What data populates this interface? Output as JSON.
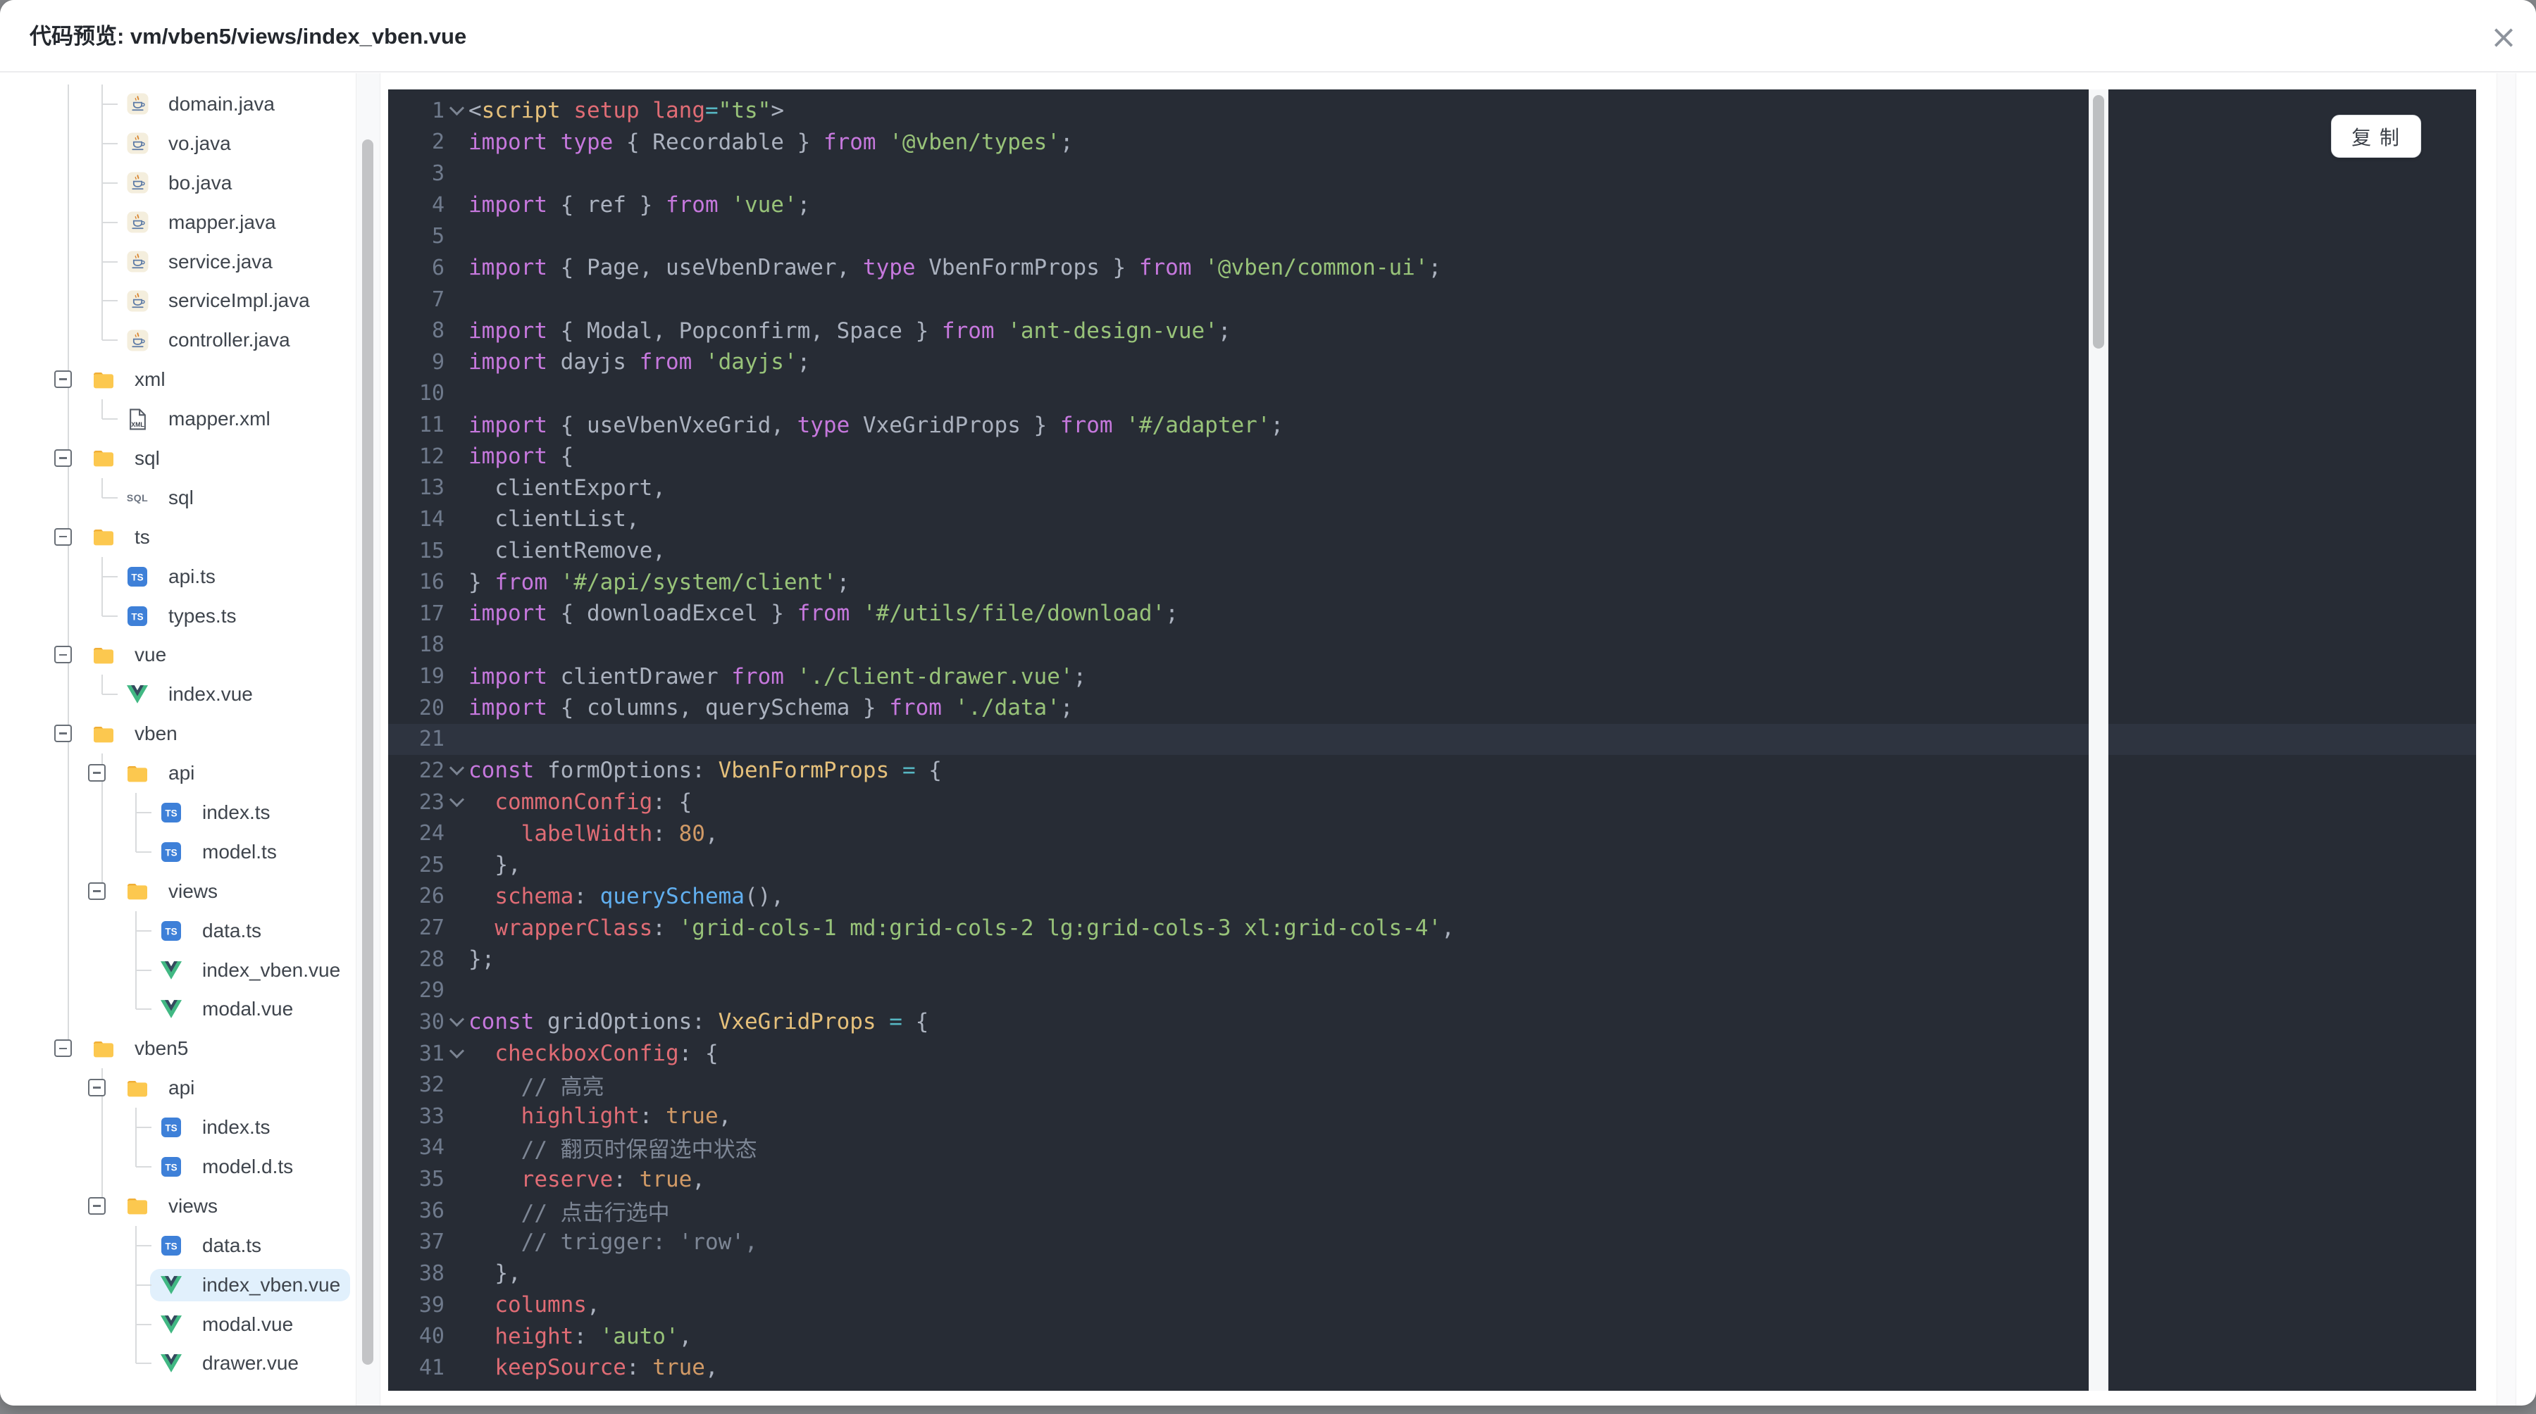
{
  "window": {
    "title": "代码预览: vm/vben5/views/index_vben.vue",
    "close_icon": "×"
  },
  "colors": {
    "code_bg": "#272c35",
    "code_active_line": "#2e3440",
    "gutter_number": "#6f7a8c",
    "token_plain": "#abb2bf",
    "token_keyword": "#c678dd",
    "token_string": "#98c379",
    "token_type": "#e5c07b",
    "token_property": "#e06c75",
    "token_number": "#d19a66",
    "token_function": "#61afef",
    "token_comment": "#7d8695",
    "token_operator": "#56b6c2",
    "selected_row_bg": "#e1f0fc",
    "folder_icon": "#fcc84f",
    "ts_badge": "#3e80d8",
    "vue_green": "#41b883",
    "vue_dark": "#35495e"
  },
  "tree": {
    "rows": [
      {
        "l": 1,
        "label": "domain.java",
        "icon": "java",
        "e": "cont",
        "g": [
          0
        ]
      },
      {
        "l": 1,
        "label": "vo.java",
        "icon": "java",
        "e": "cont",
        "g": [
          0
        ]
      },
      {
        "l": 1,
        "label": "bo.java",
        "icon": "java",
        "e": "cont",
        "g": [
          0
        ]
      },
      {
        "l": 1,
        "label": "mapper.java",
        "icon": "java",
        "e": "cont",
        "g": [
          0
        ]
      },
      {
        "l": 1,
        "label": "service.java",
        "icon": "java",
        "e": "cont",
        "g": [
          0
        ]
      },
      {
        "l": 1,
        "label": "serviceImpl.java",
        "icon": "java",
        "e": "cont",
        "g": [
          0
        ]
      },
      {
        "l": 1,
        "label": "controller.java",
        "icon": "java",
        "e": "last",
        "g": [
          0
        ]
      },
      {
        "l": 0,
        "label": "xml",
        "icon": "folder",
        "t": 1,
        "g": [
          0
        ]
      },
      {
        "l": 1,
        "label": "mapper.xml",
        "icon": "xml",
        "e": "last",
        "g": [
          0
        ]
      },
      {
        "l": 0,
        "label": "sql",
        "icon": "folder",
        "t": 1,
        "g": [
          0
        ]
      },
      {
        "l": 1,
        "label": "sql",
        "icon": "sql",
        "e": "last",
        "g": [
          0
        ]
      },
      {
        "l": 0,
        "label": "ts",
        "icon": "folder",
        "t": 1,
        "g": [
          0
        ]
      },
      {
        "l": 1,
        "label": "api.ts",
        "icon": "ts",
        "e": "cont",
        "g": [
          0
        ]
      },
      {
        "l": 1,
        "label": "types.ts",
        "icon": "ts",
        "e": "last",
        "g": [
          0
        ]
      },
      {
        "l": 0,
        "label": "vue",
        "icon": "folder",
        "t": 1,
        "g": [
          0
        ]
      },
      {
        "l": 1,
        "label": "index.vue",
        "icon": "vue",
        "e": "last",
        "g": [
          0
        ]
      },
      {
        "l": 0,
        "label": "vben",
        "icon": "folder",
        "t": 1,
        "g": [
          0
        ]
      },
      {
        "l": 1,
        "label": "api",
        "icon": "folder",
        "t": 1,
        "g": [
          0,
          1
        ]
      },
      {
        "l": 2,
        "label": "index.ts",
        "icon": "ts",
        "e": "cont",
        "g": [
          0,
          1
        ]
      },
      {
        "l": 2,
        "label": "model.ts",
        "icon": "ts",
        "e": "last",
        "g": [
          0,
          1
        ]
      },
      {
        "l": 1,
        "label": "views",
        "icon": "folder",
        "t": 1,
        "g": [
          0
        ],
        "h": [
          1
        ]
      },
      {
        "l": 2,
        "label": "data.ts",
        "icon": "ts",
        "e": "cont",
        "g": [
          0
        ]
      },
      {
        "l": 2,
        "label": "index_vben.vue",
        "icon": "vue",
        "e": "cont",
        "g": [
          0
        ]
      },
      {
        "l": 2,
        "label": "modal.vue",
        "icon": "vue",
        "e": "last",
        "g": [
          0
        ]
      },
      {
        "l": 0,
        "label": "vben5",
        "icon": "folder",
        "t": 1,
        "h": [
          0
        ]
      },
      {
        "l": 1,
        "label": "api",
        "icon": "folder",
        "t": 1,
        "g": [
          1
        ]
      },
      {
        "l": 2,
        "label": "index.ts",
        "icon": "ts",
        "e": "cont",
        "g": [
          1
        ]
      },
      {
        "l": 2,
        "label": "model.d.ts",
        "icon": "ts",
        "e": "last",
        "g": [
          1
        ]
      },
      {
        "l": 1,
        "label": "views",
        "icon": "folder",
        "t": 1,
        "h": [
          1
        ]
      },
      {
        "l": 2,
        "label": "data.ts",
        "icon": "ts",
        "e": "cont"
      },
      {
        "l": 2,
        "label": "index_vben.vue",
        "icon": "vue",
        "e": "cont",
        "sel": 1
      },
      {
        "l": 2,
        "label": "modal.vue",
        "icon": "vue",
        "e": "cont"
      },
      {
        "l": 2,
        "label": "drawer.vue",
        "icon": "vue",
        "e": "last"
      }
    ]
  },
  "code": {
    "copy_label": "复 制",
    "lines": [
      {
        "n": 1,
        "fold": true,
        "spans": [
          [
            "p",
            "<"
          ],
          [
            "t",
            "script"
          ],
          [
            "p",
            " "
          ],
          [
            "a",
            "setup"
          ],
          [
            "p",
            " "
          ],
          [
            "a",
            "lang"
          ],
          [
            "o",
            "="
          ],
          [
            "s",
            "\"ts\""
          ],
          [
            "p",
            ">"
          ]
        ]
      },
      {
        "n": 2,
        "spans": [
          [
            "k",
            "import"
          ],
          [
            "p",
            " "
          ],
          [
            "k",
            "type"
          ],
          [
            "p",
            " { Recordable } "
          ],
          [
            "k",
            "from"
          ],
          [
            "p",
            " "
          ],
          [
            "s",
            "'@vben/types'"
          ],
          [
            "p",
            ";"
          ]
        ]
      },
      {
        "n": 3,
        "spans": []
      },
      {
        "n": 4,
        "spans": [
          [
            "k",
            "import"
          ],
          [
            "p",
            " { ref } "
          ],
          [
            "k",
            "from"
          ],
          [
            "p",
            " "
          ],
          [
            "s",
            "'vue'"
          ],
          [
            "p",
            ";"
          ]
        ]
      },
      {
        "n": 5,
        "spans": []
      },
      {
        "n": 6,
        "spans": [
          [
            "k",
            "import"
          ],
          [
            "p",
            " { Page, useVbenDrawer, "
          ],
          [
            "k",
            "type"
          ],
          [
            "p",
            " VbenFormProps } "
          ],
          [
            "k",
            "from"
          ],
          [
            "p",
            " "
          ],
          [
            "s",
            "'@vben/common-ui'"
          ],
          [
            "p",
            ";"
          ]
        ]
      },
      {
        "n": 7,
        "spans": []
      },
      {
        "n": 8,
        "spans": [
          [
            "k",
            "import"
          ],
          [
            "p",
            " { Modal, Popconfirm, Space } "
          ],
          [
            "k",
            "from"
          ],
          [
            "p",
            " "
          ],
          [
            "s",
            "'ant-design-vue'"
          ],
          [
            "p",
            ";"
          ]
        ]
      },
      {
        "n": 9,
        "spans": [
          [
            "k",
            "import"
          ],
          [
            "p",
            " dayjs "
          ],
          [
            "k",
            "from"
          ],
          [
            "p",
            " "
          ],
          [
            "s",
            "'dayjs'"
          ],
          [
            "p",
            ";"
          ]
        ]
      },
      {
        "n": 10,
        "spans": []
      },
      {
        "n": 11,
        "spans": [
          [
            "k",
            "import"
          ],
          [
            "p",
            " { useVbenVxeGrid, "
          ],
          [
            "k",
            "type"
          ],
          [
            "p",
            " VxeGridProps } "
          ],
          [
            "k",
            "from"
          ],
          [
            "p",
            " "
          ],
          [
            "s",
            "'#/adapter'"
          ],
          [
            "p",
            ";"
          ]
        ]
      },
      {
        "n": 12,
        "spans": [
          [
            "k",
            "import"
          ],
          [
            "p",
            " {"
          ]
        ]
      },
      {
        "n": 13,
        "spans": [
          [
            "p",
            "  clientExport,"
          ]
        ]
      },
      {
        "n": 14,
        "spans": [
          [
            "p",
            "  clientList,"
          ]
        ]
      },
      {
        "n": 15,
        "spans": [
          [
            "p",
            "  clientRemove,"
          ]
        ]
      },
      {
        "n": 16,
        "spans": [
          [
            "p",
            "} "
          ],
          [
            "k",
            "from"
          ],
          [
            "p",
            " "
          ],
          [
            "s",
            "'#/api/system/client'"
          ],
          [
            "p",
            ";"
          ]
        ]
      },
      {
        "n": 17,
        "spans": [
          [
            "k",
            "import"
          ],
          [
            "p",
            " { downloadExcel } "
          ],
          [
            "k",
            "from"
          ],
          [
            "p",
            " "
          ],
          [
            "s",
            "'#/utils/file/download'"
          ],
          [
            "p",
            ";"
          ]
        ]
      },
      {
        "n": 18,
        "spans": []
      },
      {
        "n": 19,
        "spans": [
          [
            "k",
            "import"
          ],
          [
            "p",
            " clientDrawer "
          ],
          [
            "k",
            "from"
          ],
          [
            "p",
            " "
          ],
          [
            "s",
            "'./client-drawer.vue'"
          ],
          [
            "p",
            ";"
          ]
        ]
      },
      {
        "n": 20,
        "spans": [
          [
            "k",
            "import"
          ],
          [
            "p",
            " { columns, querySchema } "
          ],
          [
            "k",
            "from"
          ],
          [
            "p",
            " "
          ],
          [
            "s",
            "'./data'"
          ],
          [
            "p",
            ";"
          ]
        ]
      },
      {
        "n": 21,
        "active": true,
        "spans": []
      },
      {
        "n": 22,
        "fold": true,
        "spans": [
          [
            "k",
            "const"
          ],
          [
            "p",
            " formOptions: "
          ],
          [
            "t",
            "VbenFormProps"
          ],
          [
            "p",
            " "
          ],
          [
            "o",
            "="
          ],
          [
            "p",
            " {"
          ]
        ]
      },
      {
        "n": 23,
        "fold": true,
        "spans": [
          [
            "p",
            "  "
          ],
          [
            "a",
            "commonConfig"
          ],
          [
            "p",
            ": {"
          ]
        ]
      },
      {
        "n": 24,
        "spans": [
          [
            "p",
            "    "
          ],
          [
            "a",
            "labelWidth"
          ],
          [
            "p",
            ": "
          ],
          [
            "n",
            "80"
          ],
          [
            "p",
            ","
          ]
        ]
      },
      {
        "n": 25,
        "spans": [
          [
            "p",
            "  },"
          ]
        ]
      },
      {
        "n": 26,
        "spans": [
          [
            "p",
            "  "
          ],
          [
            "a",
            "schema"
          ],
          [
            "p",
            ": "
          ],
          [
            "f",
            "querySchema"
          ],
          [
            "p",
            "(),"
          ]
        ]
      },
      {
        "n": 27,
        "spans": [
          [
            "p",
            "  "
          ],
          [
            "a",
            "wrapperClass"
          ],
          [
            "p",
            ": "
          ],
          [
            "s",
            "'grid-cols-1 md:grid-cols-2 lg:grid-cols-3 xl:grid-cols-4'"
          ],
          [
            "p",
            ","
          ]
        ]
      },
      {
        "n": 28,
        "spans": [
          [
            "p",
            "};"
          ]
        ]
      },
      {
        "n": 29,
        "spans": []
      },
      {
        "n": 30,
        "fold": true,
        "spans": [
          [
            "k",
            "const"
          ],
          [
            "p",
            " gridOptions: "
          ],
          [
            "t",
            "VxeGridProps"
          ],
          [
            "p",
            " "
          ],
          [
            "o",
            "="
          ],
          [
            "p",
            " {"
          ]
        ]
      },
      {
        "n": 31,
        "fold": true,
        "spans": [
          [
            "p",
            "  "
          ],
          [
            "a",
            "checkboxConfig"
          ],
          [
            "p",
            ": {"
          ]
        ]
      },
      {
        "n": 32,
        "spans": [
          [
            "p",
            "    "
          ],
          [
            "c",
            "// 高亮"
          ]
        ]
      },
      {
        "n": 33,
        "spans": [
          [
            "p",
            "    "
          ],
          [
            "a",
            "highlight"
          ],
          [
            "p",
            ": "
          ],
          [
            "n",
            "true"
          ],
          [
            "p",
            ","
          ]
        ]
      },
      {
        "n": 34,
        "spans": [
          [
            "p",
            "    "
          ],
          [
            "c",
            "// 翻页时保留选中状态"
          ]
        ]
      },
      {
        "n": 35,
        "spans": [
          [
            "p",
            "    "
          ],
          [
            "a",
            "reserve"
          ],
          [
            "p",
            ": "
          ],
          [
            "n",
            "true"
          ],
          [
            "p",
            ","
          ]
        ]
      },
      {
        "n": 36,
        "spans": [
          [
            "p",
            "    "
          ],
          [
            "c",
            "// 点击行选中"
          ]
        ]
      },
      {
        "n": 37,
        "spans": [
          [
            "p",
            "    "
          ],
          [
            "c",
            "// trigger: 'row',"
          ]
        ]
      },
      {
        "n": 38,
        "spans": [
          [
            "p",
            "  },"
          ]
        ]
      },
      {
        "n": 39,
        "spans": [
          [
            "p",
            "  "
          ],
          [
            "a",
            "columns"
          ],
          [
            "p",
            ","
          ]
        ]
      },
      {
        "n": 40,
        "spans": [
          [
            "p",
            "  "
          ],
          [
            "a",
            "height"
          ],
          [
            "p",
            ": "
          ],
          [
            "s",
            "'auto'"
          ],
          [
            "p",
            ","
          ]
        ]
      },
      {
        "n": 41,
        "spans": [
          [
            "p",
            "  "
          ],
          [
            "a",
            "keepSource"
          ],
          [
            "p",
            ": "
          ],
          [
            "n",
            "true"
          ],
          [
            "p",
            ","
          ]
        ]
      }
    ]
  }
}
